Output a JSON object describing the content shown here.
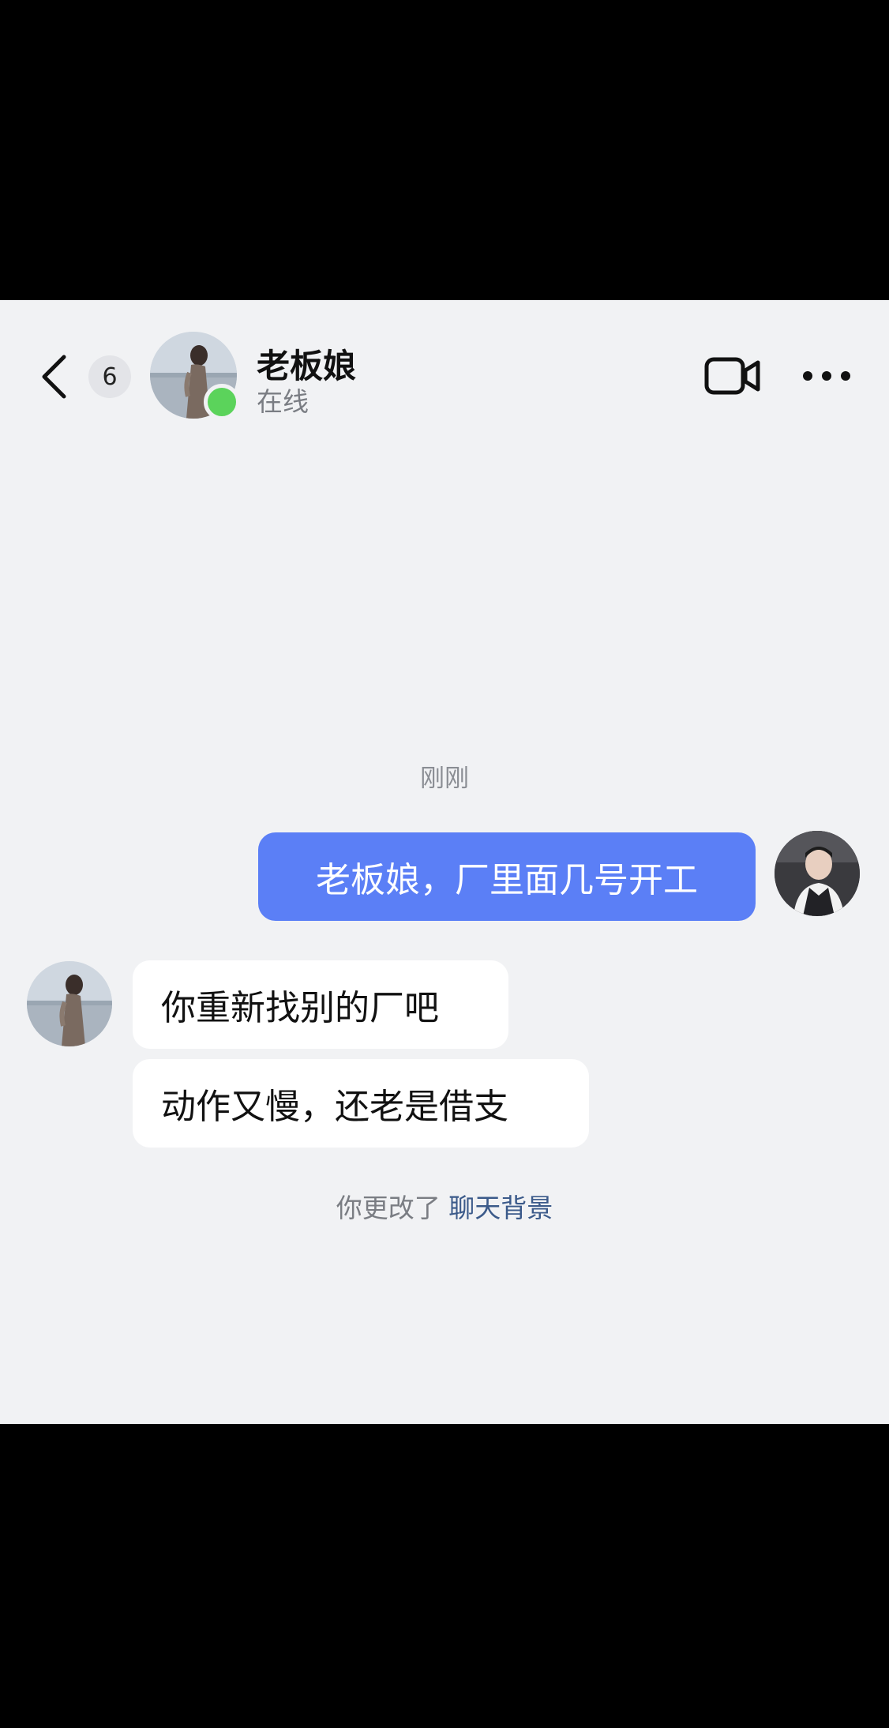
{
  "header": {
    "unread_count": "6",
    "contact_name": "老板娘",
    "contact_status": "在线"
  },
  "chat": {
    "timestamp": "刚刚",
    "messages": [
      {
        "sender": "me",
        "text": "老板娘，厂里面几号开工"
      },
      {
        "sender": "them",
        "text": "你重新找别的厂吧"
      },
      {
        "sender": "them",
        "text": "动作又慢，还老是借支"
      }
    ],
    "system_note": {
      "prefix": "你更改了",
      "link": "聊天背景"
    }
  },
  "icons": {
    "back": "chevron-left-icon",
    "video": "video-camera-icon",
    "more": "more-dots-icon"
  },
  "colors": {
    "my_bubble": "#5b7ff6",
    "their_bubble": "#ffffff",
    "online": "#5bd35b",
    "background": "#f1f2f4",
    "link": "#3b5a8a"
  }
}
